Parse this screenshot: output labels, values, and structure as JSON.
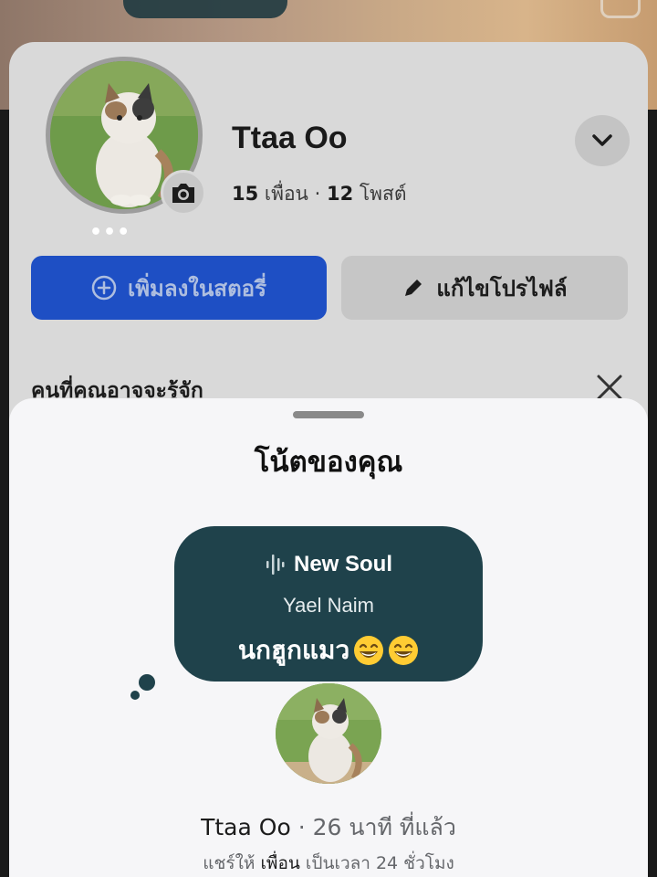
{
  "profile": {
    "name": "Ttaa Oo",
    "friends_count": "15",
    "friends_label": "เพื่อน",
    "separator": "·",
    "posts_count": "12",
    "posts_label": "โพสต์",
    "more_dots": "•••"
  },
  "actions": {
    "add_story_label": "เพิ่มลงในสตอรี่",
    "edit_profile_label": "แก้ไขโปรไฟล์"
  },
  "pymk": {
    "title": "คนที่คุณอาจจะรู้จัก"
  },
  "note_sheet": {
    "title": "โน้ตของคุณ",
    "song_title": "New Soul",
    "song_artist": "Yael Naim",
    "note_text": "นกฮูกแมว",
    "author": "Ttaa Oo",
    "time_ago": "· 26 นาที ที่แล้ว",
    "share_prefix": "แชร์ให้",
    "share_audience": "เพื่อน",
    "share_suffix": "เป็นเวลา 24 ชั่วโมง"
  },
  "icons": {
    "camera": "camera-icon",
    "chevron": "chevron-down-icon",
    "add_story": "plus-circle-icon",
    "edit": "pencil-icon",
    "close": "close-icon",
    "music": "music-wave-icon",
    "emoji": "grinning-face-icon"
  },
  "colors": {
    "primary_button": "#1e4fc4",
    "note_bubble": "#1f424b",
    "sheet_bg": "#f6f6f8"
  }
}
